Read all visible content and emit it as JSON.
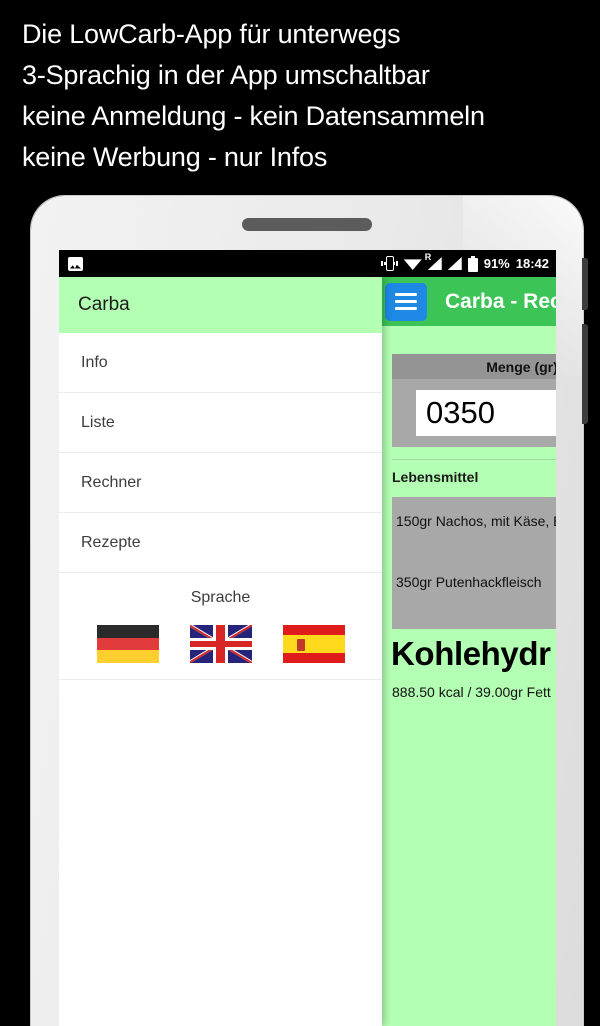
{
  "promo": {
    "lines": [
      "Die LowCarb-App für unterwegs",
      "3-Sprachig in der App umschaltbar",
      "keine Anmeldung - kein Datensammeln",
      "keine Werbung - nur Infos"
    ]
  },
  "statusbar": {
    "gallery_icon": "gallery-icon",
    "vibrate_icon": "vibrate-icon",
    "wifi_icon": "wifi-icon",
    "roaming_label": "R",
    "signal_icon": "signal-icon",
    "signal2_icon": "signal-icon",
    "battery_icon": "battery-icon",
    "battery_percent": "91%",
    "clock": "18:42"
  },
  "drawer": {
    "header_title": "Carba",
    "items": [
      {
        "label": "Info"
      },
      {
        "label": "Liste"
      },
      {
        "label": "Rechner"
      },
      {
        "label": "Rezepte"
      }
    ],
    "language": {
      "title": "Sprache",
      "flags": [
        {
          "name": "german-flag",
          "code": "de"
        },
        {
          "name": "uk-flag",
          "code": "en"
        },
        {
          "name": "spanish-flag",
          "code": "es"
        }
      ]
    }
  },
  "app": {
    "menu_icon": "hamburger-menu-icon",
    "title": "Carba - Rec",
    "amount_card": {
      "header": "Menge (gr)",
      "value": "0350"
    },
    "foods_label": "Lebensmittel",
    "foods": [
      {
        "label": "150gr Nachos, mit Käse, B"
      },
      {
        "label": "350gr Putenhackfleisch"
      }
    ],
    "result_title": "Kohlehydr",
    "result_sub": "888.50 kcal / 39.00gr Fett"
  },
  "colors": {
    "page_bg": "#000000",
    "drawer_header_green": "#b3ffb3",
    "app_toolbar_green": "#3cc556",
    "menu_button_blue": "#1e88e5",
    "card_gray": "#a8a8a8",
    "card_header_gray": "#949494"
  }
}
